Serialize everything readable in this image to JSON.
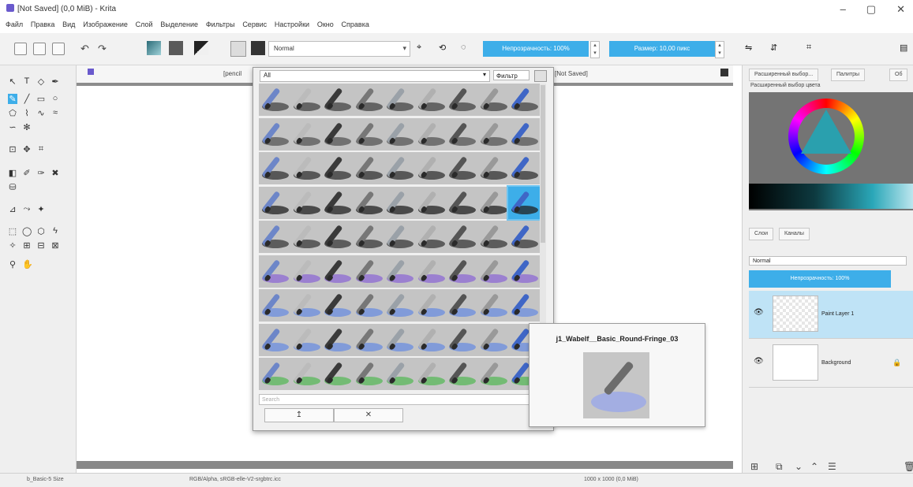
{
  "window": {
    "title": "[Not Saved] (0,0 MiB) - Krita",
    "controls": [
      "–",
      "▢",
      "✕"
    ]
  },
  "menu": [
    "Файл",
    "Правка",
    "Вид",
    "Изображение",
    "Слой",
    "Выделение",
    "Фильтры",
    "Сервис",
    "Настройки",
    "Окно",
    "Справка"
  ],
  "toolbar": {
    "blend_mode": "Normal",
    "opacity_label": "Непрозрачность: 100%",
    "size_label": "Размер: 10,00 пикс"
  },
  "canvas": {
    "tab_left": "[pencil",
    "tab_right": "[Not Saved]"
  },
  "brush_popup": {
    "tag": "All",
    "filter_label": "Фильтр",
    "search_placeholder": "Search",
    "btn_add": "↥",
    "btn_remove": "✕",
    "presets_count": 81,
    "selected_index": 35
  },
  "tooltip": {
    "preset_name": "j1_Wabelf__Basic_Round-Fringe_03"
  },
  "docker": {
    "tabs": [
      "Расширенный выбор...",
      "Палитры",
      "Об"
    ],
    "color_panel_label": "Расширенный выбор цвета",
    "layers_tabs": [
      "Слои",
      "Каналы"
    ],
    "blend_mode": "Normal",
    "opacity_label": "Непрозрачность: 100%",
    "layers": [
      {
        "name": "Paint Layer 1",
        "selected": true
      },
      {
        "name": "Background",
        "selected": false
      }
    ]
  },
  "status": {
    "left": "b_Basic-5 Size",
    "middle": "RGB/Alpha, sRGB-elle-V2-srgbtrc.icc",
    "right": "1000 x 1000 (0,0 MiB)"
  },
  "colors": {
    "accent": "#3daee9",
    "panel": "#efefef",
    "cell": "#c4c4c4"
  }
}
